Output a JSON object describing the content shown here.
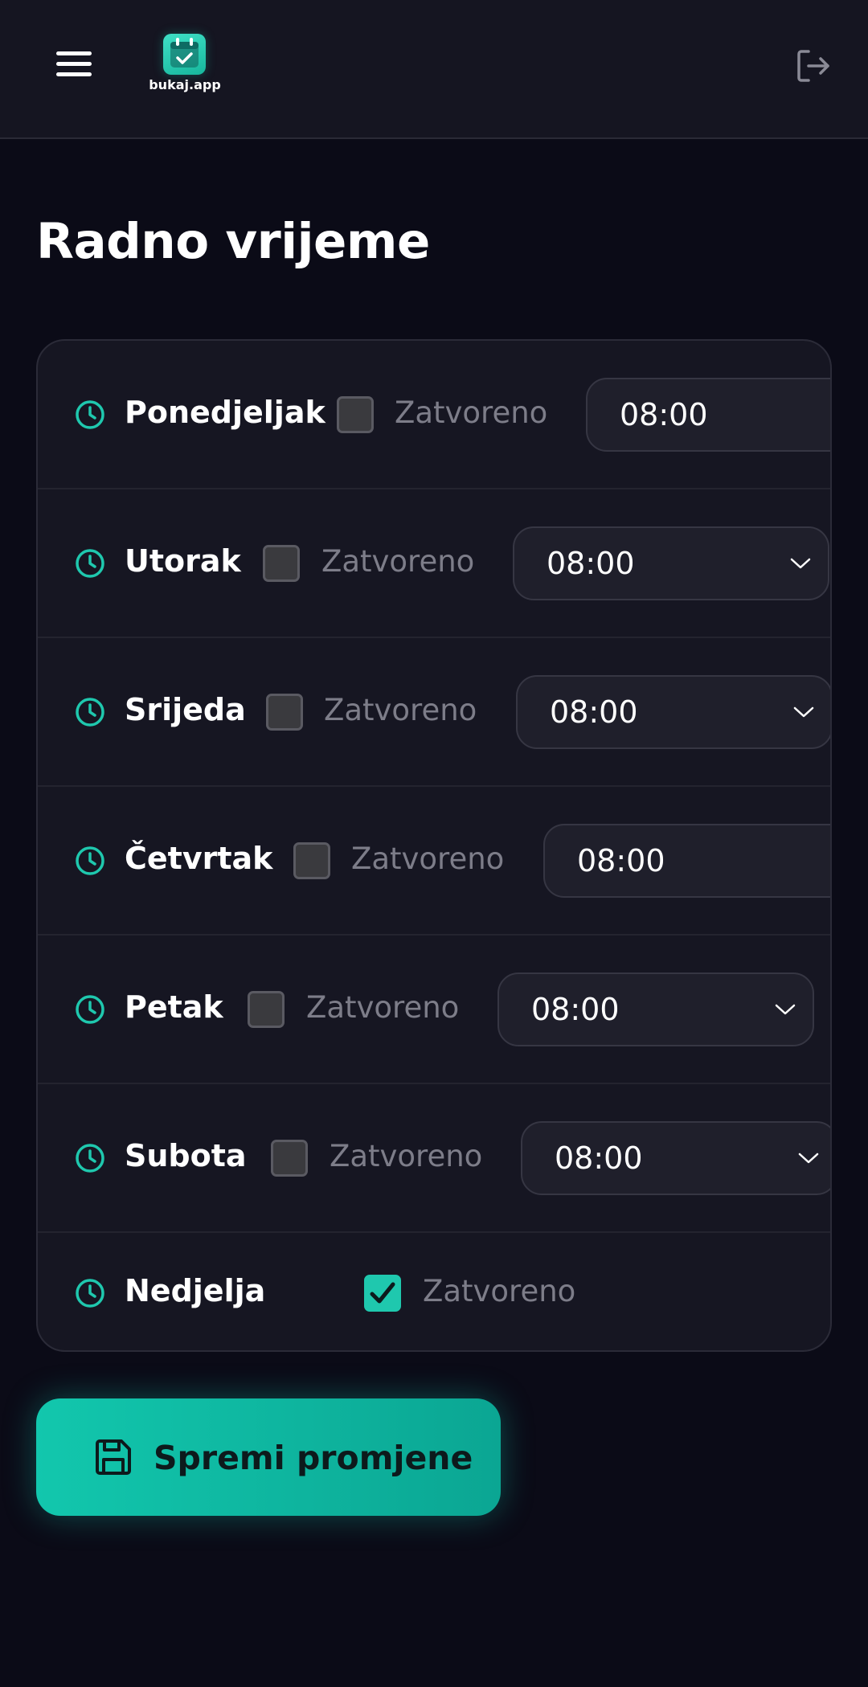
{
  "header": {
    "menu_icon": "hamburger-menu-icon",
    "logo_icon": "calendar-check-icon",
    "logo_text": "bukaj.app",
    "logout_icon": "logout-icon"
  },
  "page": {
    "title": "Radno vrijeme"
  },
  "schedule": {
    "closed_label": "Zatvoreno",
    "days": [
      {
        "name": "Ponedjeljak",
        "closed": false,
        "time": "08:00"
      },
      {
        "name": "Utorak",
        "closed": false,
        "time": "08:00"
      },
      {
        "name": "Srijeda",
        "closed": false,
        "time": "08:00"
      },
      {
        "name": "Četvrtak",
        "closed": false,
        "time": "08:00"
      },
      {
        "name": "Petak",
        "closed": false,
        "time": "08:00"
      },
      {
        "name": "Subota",
        "closed": false,
        "time": "08:00"
      },
      {
        "name": "Nedjelja",
        "closed": true,
        "time": ""
      }
    ]
  },
  "actions": {
    "save_label": "Spremi promjene",
    "save_icon": "save-icon"
  },
  "colors": {
    "background": "#0b0b17",
    "accent": "#1fc8ae",
    "card": "#161622"
  }
}
